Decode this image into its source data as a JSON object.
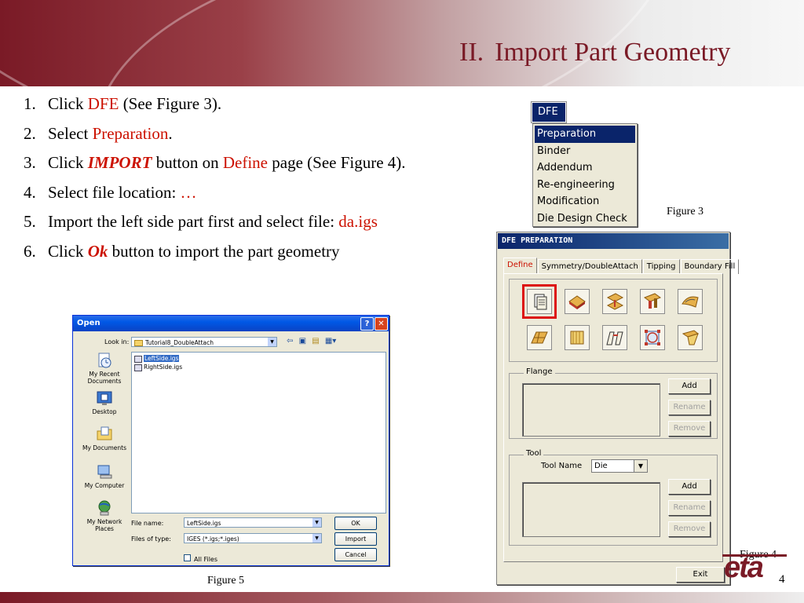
{
  "slide": {
    "title_number": "II.",
    "title_text": "Import Part Geometry",
    "page_number": "4",
    "logo_text": "eta"
  },
  "steps": [
    {
      "num": "1.",
      "pre": "Click ",
      "hl": "DFE",
      "post": " (See Figure 3)."
    },
    {
      "num": "2.",
      "pre": "Select ",
      "hl": "Preparation",
      "post": "."
    },
    {
      "num": "3.",
      "pre": "Click ",
      "hl": "IMPORT",
      "mid": " button on ",
      "hl2": "Define",
      "post": " page (See Figure 4)."
    },
    {
      "num": "4.",
      "pre": "Select file location: ",
      "hl": "…"
    },
    {
      "num": "5.",
      "pre": "Import the left side part first and select file: ",
      "hl": "da.igs"
    },
    {
      "num": "6.",
      "pre": "Click ",
      "hl": "Ok",
      "post": " button to import the part geometry"
    }
  ],
  "figure3": {
    "menu_title": "DFE",
    "items": [
      "Preparation",
      "Binder",
      "Addendum",
      "Re-engineering",
      "Modification",
      "Die Design Check"
    ],
    "selected_index": 0,
    "caption": "Figure 3"
  },
  "figure4": {
    "title": "DFE PREPARATION",
    "tabs": [
      "Define",
      "Symmetry/DoubleAttach",
      "Tipping",
      "Boundary Fill"
    ],
    "active_tab": 0,
    "icons": [
      "import-icon",
      "part-icon",
      "offset-icon",
      "transform-icon",
      "surface-icon",
      "mesh-icon",
      "fill-icon",
      "flip-icon",
      "check-icon",
      "edge-icon"
    ],
    "flange": {
      "label": "Flange",
      "buttons": [
        "Add",
        "Rename",
        "Remove"
      ]
    },
    "tool": {
      "label": "Tool",
      "name_label": "Tool Name",
      "name_value": "Die",
      "buttons": [
        "Add",
        "Rename",
        "Remove"
      ]
    },
    "exit_label": "Exit",
    "caption": "Figure 4"
  },
  "figure5": {
    "title": "Open",
    "look_in_label": "Look in:",
    "look_in_value": "Tutorial8_DoubleAttach",
    "places": [
      "My Recent Documents",
      "Desktop",
      "My Documents",
      "My Computer",
      "My Network Places"
    ],
    "files": [
      "LeftSide.igs",
      "RightSide.igs"
    ],
    "selected_file": 0,
    "file_name_label": "File name:",
    "file_name_value": "LeftSide.igs",
    "files_of_type_label": "Files of type:",
    "files_of_type_value": "IGES (*.igs;*.iges)",
    "all_files_label": "All Files",
    "buttons": [
      "OK",
      "Import",
      "Cancel"
    ],
    "caption": "Figure 5"
  }
}
